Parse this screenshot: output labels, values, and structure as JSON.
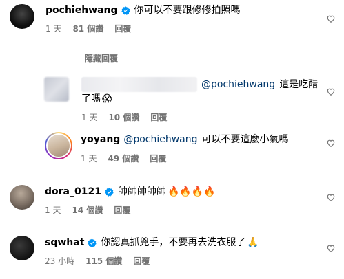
{
  "hide_replies": "隱藏回覆",
  "comments": [
    {
      "username": "pochiehwang",
      "verified": true,
      "text": "你可以不要跟修修拍照嗎",
      "time": "1 天",
      "likes": "81 個讚",
      "reply": "回覆",
      "avatar_color": "#1a1a1a"
    },
    {
      "username": "",
      "mention": "@pochiehwang",
      "text_a": "這是吃醋",
      "text_b": "了嗎",
      "emoji": "😱",
      "time": "1 天",
      "likes": "10 個讚",
      "reply": "回覆",
      "avatar_color": "#c9ccd6"
    },
    {
      "username": "yoyang",
      "mention": "@pochiehwang",
      "text": "可以不要這麼小氣嗎",
      "time": "1 天",
      "likes": "49 個讚",
      "reply": "回覆",
      "avatar_color": "#d9cbb8"
    },
    {
      "username": "dora_0121",
      "verified": true,
      "text": "帥帥帥帥帥",
      "emoji": "🔥🔥🔥🔥",
      "time": "1 天",
      "likes": "14 個讚",
      "reply": "回覆",
      "avatar_color": "#8a8077"
    },
    {
      "username": "sqwhat",
      "verified": true,
      "text": "你認真抓兇手，不要再去洗衣服了",
      "emoji": "🙏",
      "time": "23 小時",
      "likes": "115 個讚",
      "reply": "回覆",
      "avatar_color": "#1c1c1c"
    }
  ],
  "colors": {
    "verified": "#0095f6",
    "muted": "#737373",
    "mention": "#00376b"
  },
  "icons": {
    "verified": "verified-badge-icon",
    "like": "heart-icon"
  }
}
